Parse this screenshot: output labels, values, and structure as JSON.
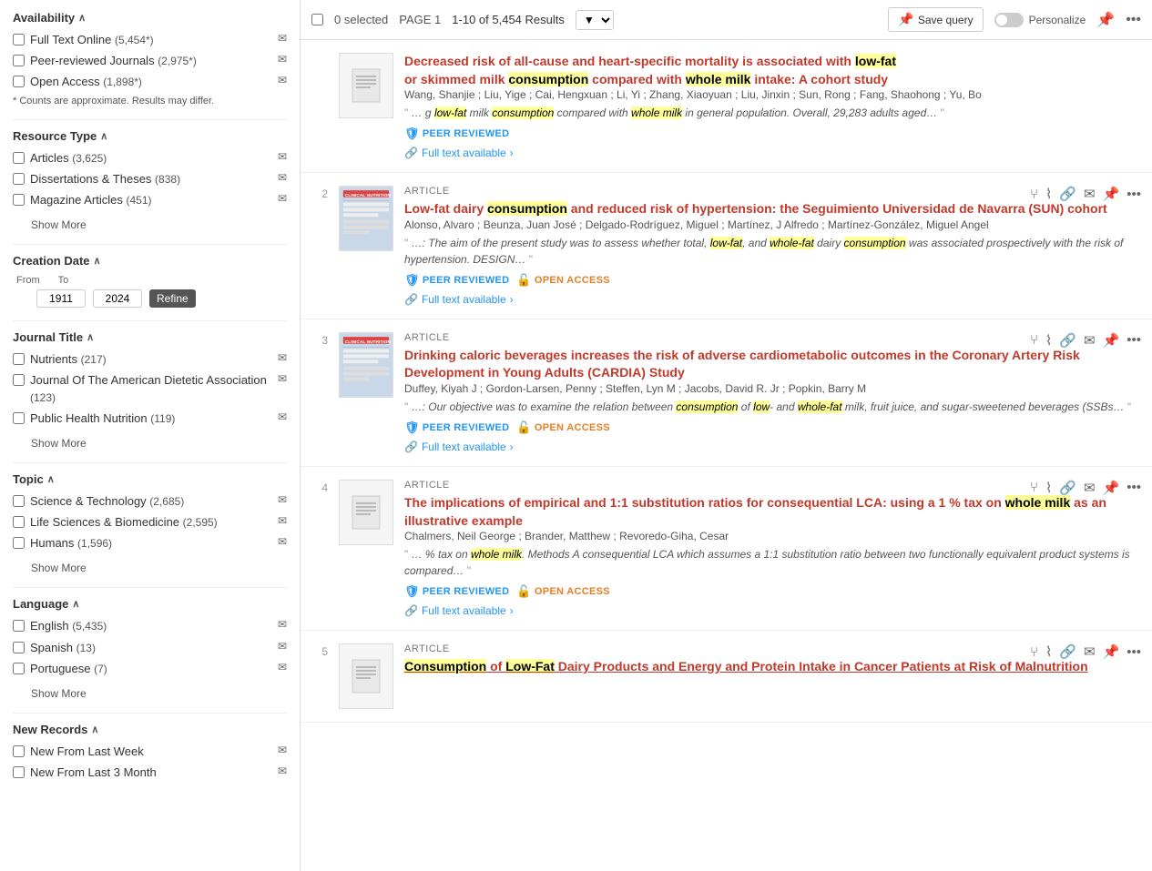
{
  "sidebar": {
    "availability": {
      "title": "Availability",
      "items": [
        {
          "label": "Full Text Online",
          "count": "(5,454*)",
          "checked": false
        },
        {
          "label": "Peer-reviewed Journals",
          "count": "(2,975*)",
          "checked": false
        },
        {
          "label": "Open Access",
          "count": "(1,898*)",
          "checked": false
        }
      ],
      "note": "* Counts are approximate. Results may differ."
    },
    "resource_type": {
      "title": "Resource Type",
      "items": [
        {
          "label": "Articles",
          "count": "(3,625)",
          "checked": false
        },
        {
          "label": "Dissertations & Theses",
          "count": "(838)",
          "checked": false
        },
        {
          "label": "Magazine Articles",
          "count": "(451)",
          "checked": false
        }
      ],
      "show_more": "Show More"
    },
    "creation_date": {
      "title": "Creation Date",
      "from_label": "From",
      "to_label": "To",
      "from_value": "1911",
      "to_value": "2024",
      "refine_label": "Refine"
    },
    "journal_title": {
      "title": "Journal Title",
      "items": [
        {
          "label": "Nutrients",
          "count": "(217)",
          "checked": false
        },
        {
          "label": "Journal Of The American Dietetic Association",
          "count": "(123)",
          "checked": false
        },
        {
          "label": "Public Health Nutrition",
          "count": "(119)",
          "checked": false
        }
      ],
      "show_more": "Show More"
    },
    "topic": {
      "title": "Topic",
      "items": [
        {
          "label": "Science & Technology",
          "count": "(2,685)",
          "checked": false
        },
        {
          "label": "Life Sciences & Biomedicine",
          "count": "(2,595)",
          "checked": false
        },
        {
          "label": "Humans",
          "count": "(1,596)",
          "checked": false
        }
      ],
      "show_more": "Show More"
    },
    "language": {
      "title": "Language",
      "items": [
        {
          "label": "English",
          "count": "(5,435)",
          "checked": false
        },
        {
          "label": "Spanish",
          "count": "(13)",
          "checked": false
        },
        {
          "label": "Portuguese",
          "count": "(7)",
          "checked": false
        }
      ],
      "show_more": "Show More"
    },
    "new_records": {
      "title": "New Records",
      "items": [
        {
          "label": "New From Last Week",
          "checked": false
        },
        {
          "label": "New From Last 3 Month",
          "checked": false
        }
      ]
    }
  },
  "topbar": {
    "selected_count": "0 selected",
    "page_label": "PAGE 1",
    "results_range": "1-10 of 5,454 Results",
    "save_query": "Save query",
    "personalize": "Personalize"
  },
  "results": [
    {
      "num": "",
      "type": "",
      "title": "Decreased risk of all-cause and heart-specific mortality is associated with low-fat or skimmed milk consumption compared with whole milk intake: A cohort study",
      "authors": "Wang, Shanjie ; Liu, Yige ; Cai, Hengxuan ; Li, Yi ; Zhang, Xiaoyuan ; Liu, Jinxin ; Sun, Rong ; Fang, Shaohong ; Yu, Bo",
      "snippet": "… g low-fat milk consumption compared with whole milk in general population. Overall, 29,283 adults aged…",
      "peer_reviewed": true,
      "open_access": false,
      "full_text": "Full text available",
      "has_thumb": false,
      "thumb_type": "doc"
    },
    {
      "num": "2",
      "type": "ARTICLE",
      "title": "Low-fat dairy consumption and reduced risk of hypertension: the Seguimiento Universidad de Navarra (SUN) cohort",
      "authors": "Alonso, Alvaro ; Beunza, Juan José ; Delgado-Rodríguez, Miguel ; Martínez, J Alfredo ; Martínez-González, Miguel Angel",
      "snippet": "…: The aim of the present study was to assess whether total, low-fat, and whole-fat dairy consumption was associated prospectively with the risk of hypertension. DESIGN…",
      "peer_reviewed": true,
      "open_access": true,
      "full_text": "Full text available",
      "has_thumb": true,
      "thumb_type": "journal"
    },
    {
      "num": "3",
      "type": "ARTICLE",
      "title": "Drinking caloric beverages increases the risk of adverse cardiometabolic outcomes in the Coronary Artery Risk Development in Young Adults (CARDIA) Study",
      "authors": "Duffey, Kiyah J ; Gordon-Larsen, Penny ; Steffen, Lyn M ; Jacobs, David R. Jr ; Popkin, Barry M",
      "snippet": "…: Our objective was to examine the relation between consumption of low- and whole-fat milk, fruit juice, and sugar-sweetened beverages (SSBs…",
      "peer_reviewed": true,
      "open_access": true,
      "full_text": "Full text available",
      "has_thumb": true,
      "thumb_type": "journal"
    },
    {
      "num": "4",
      "type": "ARTICLE",
      "title": "The implications of empirical and 1:1 substitution ratios for consequential LCA: using a 1 % tax on whole milk as an illustrative example",
      "authors": "Chalmers, Neil George ; Brander, Matthew ; Revoredo-Giha, Cesar",
      "snippet": "… % tax on whole milk. Methods A consequential LCA which assumes a 1:1 substitution ratio between two functionally equivalent product systems is compared…",
      "peer_reviewed": true,
      "open_access": true,
      "full_text": "Full text available",
      "has_thumb": false,
      "thumb_type": "doc"
    },
    {
      "num": "5",
      "type": "ARTICLE",
      "title": "Consumption of Low-Fat Dairy Products and Energy and Protein Intake in Cancer Patients at Risk of Malnutrition",
      "authors": "",
      "snippet": "",
      "peer_reviewed": false,
      "open_access": false,
      "full_text": "",
      "has_thumb": false,
      "thumb_type": "doc"
    }
  ]
}
